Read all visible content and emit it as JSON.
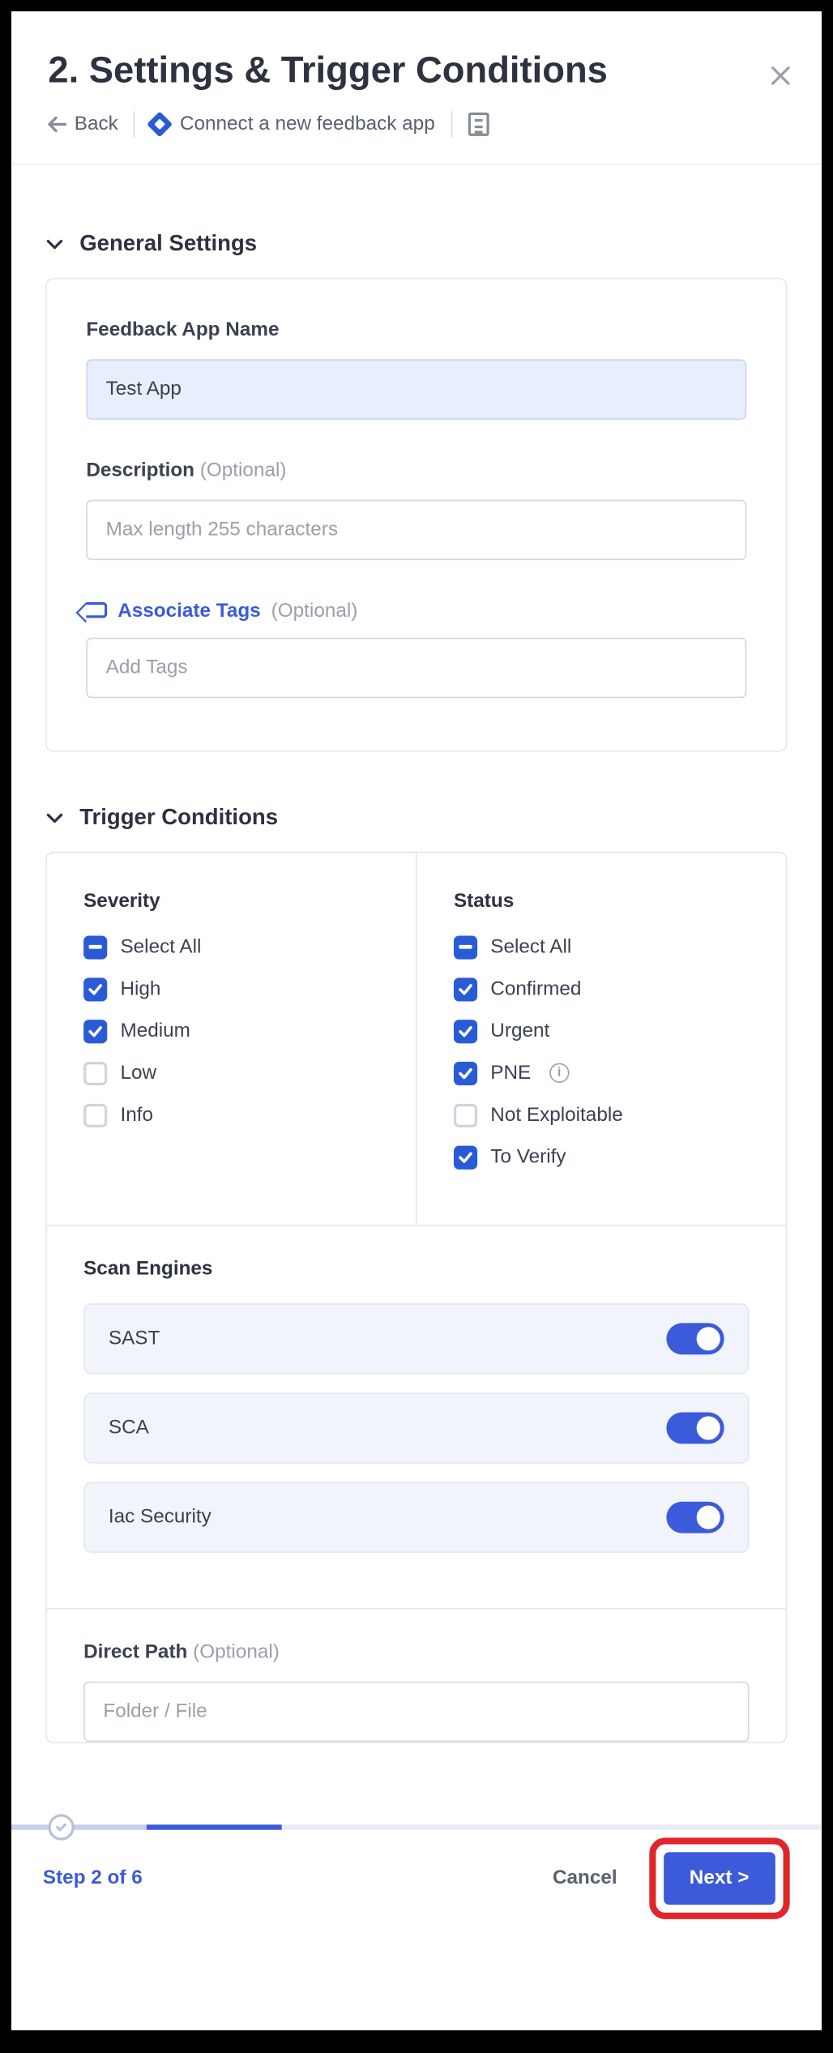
{
  "header": {
    "title": "2. Settings & Trigger Conditions",
    "back": "Back",
    "connect": "Connect a new feedback app"
  },
  "general": {
    "section_title": "General Settings",
    "name_label": "Feedback App Name",
    "name_value": "Test App",
    "desc_label": "Description",
    "desc_optional": "(Optional)",
    "desc_placeholder": "Max length 255 characters",
    "tags_label": "Associate Tags",
    "tags_optional": "(Optional)",
    "tags_placeholder": "Add Tags"
  },
  "trigger": {
    "section_title": "Trigger Conditions",
    "severity": {
      "heading": "Severity",
      "items": [
        {
          "label": "Select All",
          "state": "indet"
        },
        {
          "label": "High",
          "state": "checked"
        },
        {
          "label": "Medium",
          "state": "checked"
        },
        {
          "label": "Low",
          "state": "unchecked"
        },
        {
          "label": "Info",
          "state": "unchecked"
        }
      ]
    },
    "status": {
      "heading": "Status",
      "items": [
        {
          "label": "Select All",
          "state": "indet"
        },
        {
          "label": "Confirmed",
          "state": "checked"
        },
        {
          "label": "Urgent",
          "state": "checked"
        },
        {
          "label": "PNE",
          "state": "checked",
          "info": true
        },
        {
          "label": "Not Exploitable",
          "state": "unchecked"
        },
        {
          "label": "To Verify",
          "state": "checked"
        }
      ]
    },
    "engines": {
      "heading": "Scan Engines",
      "rows": [
        {
          "label": "SAST",
          "on": true
        },
        {
          "label": "SCA",
          "on": true
        },
        {
          "label": "Iac Security",
          "on": true
        }
      ]
    },
    "direct": {
      "label": "Direct Path",
      "optional": "(Optional)",
      "placeholder": "Folder / File"
    }
  },
  "footer": {
    "step": "Step 2 of 6",
    "cancel": "Cancel",
    "next": "Next >"
  }
}
